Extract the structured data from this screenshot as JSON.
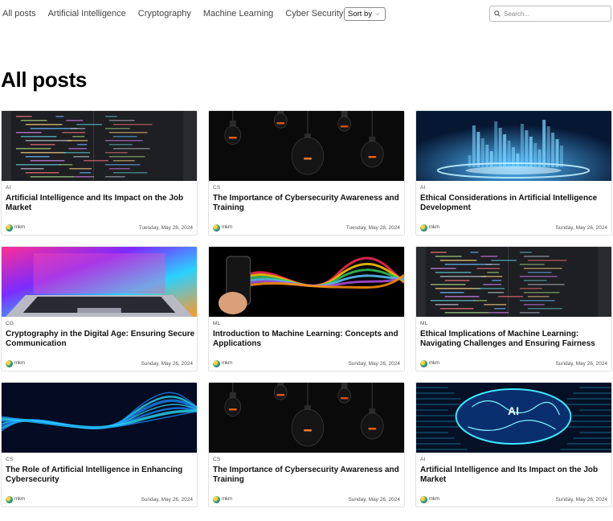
{
  "nav": {
    "items": [
      "All posts",
      "Artificial Intelligence",
      "Cryptography",
      "Machine Learning",
      "Cyber Security"
    ],
    "sort_label": "Sort by"
  },
  "search": {
    "placeholder": "Search..."
  },
  "page_title": "All posts",
  "posts": [
    {
      "category": "AI",
      "title": "Artificial Intelligence and Its Impact on the Job Market",
      "author": "mkm",
      "date": "Tuesday, May 28, 2024",
      "image": "code"
    },
    {
      "category": "CS",
      "title": "The Importance of Cybersecurity Awareness and Training",
      "author": "mkm",
      "date": "Tuesday, May 28, 2024",
      "image": "bulbs"
    },
    {
      "category": "AI",
      "title": "Ethical Considerations in Artificial Intelligence Development",
      "author": "mkm",
      "date": "Sunday, May 26, 2024",
      "image": "city"
    },
    {
      "category": "CG",
      "title": "Cryptography in the Digital Age: Ensuring Secure Communication",
      "author": "mkm",
      "date": "Sunday, May 26, 2024",
      "image": "laptop"
    },
    {
      "category": "ML",
      "title": "Introduction to Machine Learning: Concepts and Applications",
      "author": "mkm",
      "date": "Sunday, May 26, 2024",
      "image": "phone-waves"
    },
    {
      "category": "ML",
      "title": "Ethical Implications of Machine Learning: Navigating Challenges and Ensuring Fairness",
      "author": "mkm",
      "date": "Sunday, May 26, 2024",
      "image": "code"
    },
    {
      "category": "CS",
      "title": "The Role of Artificial Intelligence in Enhancing Cybersecurity",
      "author": "mkm",
      "date": "Sunday, May 26, 2024",
      "image": "blue-waves"
    },
    {
      "category": "CS",
      "title": "The Importance of Cybersecurity Awareness and Training",
      "author": "mkm",
      "date": "Sunday, May 26, 2024",
      "image": "bulbs"
    },
    {
      "category": "AI",
      "title": "Artificial Intelligence and Its Impact on the Job Market",
      "author": "mkm",
      "date": "Sunday, May 26, 2024",
      "image": "ai-brain"
    }
  ],
  "ai_brain_text": "AI",
  "colors": {
    "text": "#111111",
    "muted": "#555555",
    "border": "#e3e3e3"
  }
}
